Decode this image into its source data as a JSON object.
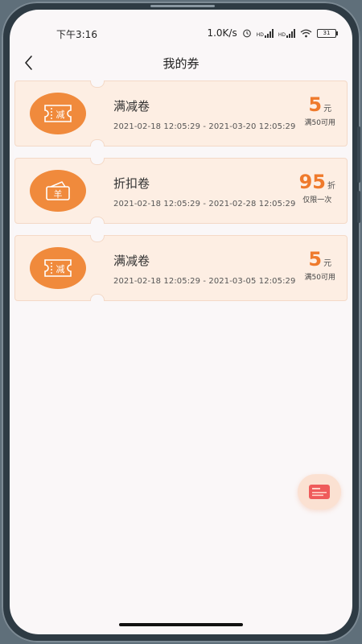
{
  "status_bar": {
    "time": "下午3:16",
    "network_speed": "1.0K/s",
    "signal1_label": "HD",
    "signal2_label": "HD",
    "battery": "31"
  },
  "header": {
    "title": "我的券"
  },
  "coupons": [
    {
      "name": "满减卷",
      "dates": "2021-02-18 12:05:29 - 2021-03-20 12:05:29",
      "amount": "5",
      "unit": "元",
      "condition": "满50可用",
      "icon_text": "减",
      "icon": "ticket-icon"
    },
    {
      "name": "折扣卷",
      "dates": "2021-02-18 12:05:29 - 2021-02-28 12:05:29",
      "amount": "95",
      "unit": "折",
      "condition": "仅限一次",
      "icon_text": "羊",
      "icon": "yen-wallet-icon"
    },
    {
      "name": "满减卷",
      "dates": "2021-02-18 12:05:29 - 2021-03-05 12:05:29",
      "amount": "5",
      "unit": "元",
      "condition": "满50可用",
      "icon_text": "减",
      "icon": "ticket-icon"
    }
  ],
  "colors": {
    "accent": "#ef7a2c",
    "badge": "#f08a3c",
    "card_bg": "#fdeee3"
  }
}
